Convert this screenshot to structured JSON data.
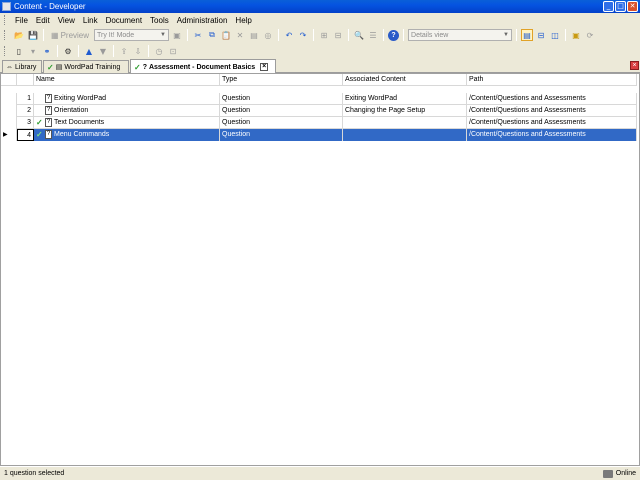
{
  "window": {
    "title": "Content - Developer",
    "controls": [
      "minimize",
      "maximize",
      "close"
    ]
  },
  "menu": {
    "items": [
      {
        "label": "File"
      },
      {
        "label": "Edit"
      },
      {
        "label": "View"
      },
      {
        "label": "Link"
      },
      {
        "label": "Document"
      },
      {
        "label": "Tools"
      },
      {
        "label": "Administration"
      },
      {
        "label": "Help"
      }
    ]
  },
  "toolbar": {
    "preview_label": "Preview",
    "mode_select": "Try It! Mode",
    "view_select": "Details view"
  },
  "tabs": [
    {
      "label": "Library",
      "active": false
    },
    {
      "label": "WordPad Training",
      "active": false,
      "checked": true
    },
    {
      "label": "Assessment - Document Basics",
      "active": true,
      "checked": true
    }
  ],
  "grid": {
    "columns": [
      "Name",
      "Type",
      "Associated Content",
      "Path"
    ],
    "rows": [
      {
        "num": "1",
        "name": "Exiting WordPad",
        "type": "Question",
        "associated": "Exiting WordPad",
        "path": "/Content/Questions and Assessments",
        "checked": false,
        "selected": false
      },
      {
        "num": "2",
        "name": "Orientation",
        "type": "Question",
        "associated": "Changing the Page Setup",
        "path": "/Content/Questions and Assessments",
        "checked": false,
        "selected": false
      },
      {
        "num": "3",
        "name": "Text Documents",
        "type": "Question",
        "associated": "",
        "path": "/Content/Questions and Assessments",
        "checked": true,
        "selected": false
      },
      {
        "num": "4",
        "name": "Menu Commands",
        "type": "Question",
        "associated": "",
        "path": "/Content/Questions and Assessments",
        "checked": true,
        "selected": true
      }
    ]
  },
  "status": {
    "left": "1 question selected",
    "right": "Online"
  },
  "colors": {
    "titlebar": "#0553e0",
    "selection": "#3169c6",
    "check": "#2e9c2e"
  }
}
